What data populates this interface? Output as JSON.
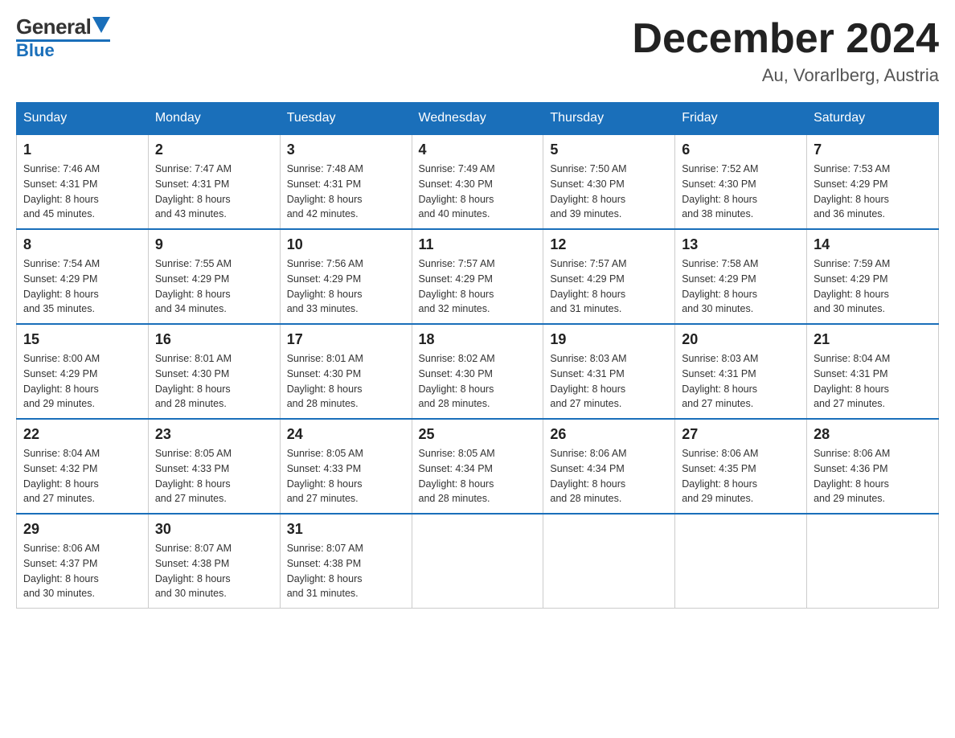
{
  "header": {
    "logo_general": "General",
    "logo_blue": "Blue",
    "title": "December 2024",
    "location": "Au, Vorarlberg, Austria"
  },
  "days_of_week": [
    "Sunday",
    "Monday",
    "Tuesday",
    "Wednesday",
    "Thursday",
    "Friday",
    "Saturday"
  ],
  "weeks": [
    [
      {
        "day": "1",
        "sunrise": "7:46 AM",
        "sunset": "4:31 PM",
        "daylight": "8 hours and 45 minutes."
      },
      {
        "day": "2",
        "sunrise": "7:47 AM",
        "sunset": "4:31 PM",
        "daylight": "8 hours and 43 minutes."
      },
      {
        "day": "3",
        "sunrise": "7:48 AM",
        "sunset": "4:31 PM",
        "daylight": "8 hours and 42 minutes."
      },
      {
        "day": "4",
        "sunrise": "7:49 AM",
        "sunset": "4:30 PM",
        "daylight": "8 hours and 40 minutes."
      },
      {
        "day": "5",
        "sunrise": "7:50 AM",
        "sunset": "4:30 PM",
        "daylight": "8 hours and 39 minutes."
      },
      {
        "day": "6",
        "sunrise": "7:52 AM",
        "sunset": "4:30 PM",
        "daylight": "8 hours and 38 minutes."
      },
      {
        "day": "7",
        "sunrise": "7:53 AM",
        "sunset": "4:29 PM",
        "daylight": "8 hours and 36 minutes."
      }
    ],
    [
      {
        "day": "8",
        "sunrise": "7:54 AM",
        "sunset": "4:29 PM",
        "daylight": "8 hours and 35 minutes."
      },
      {
        "day": "9",
        "sunrise": "7:55 AM",
        "sunset": "4:29 PM",
        "daylight": "8 hours and 34 minutes."
      },
      {
        "day": "10",
        "sunrise": "7:56 AM",
        "sunset": "4:29 PM",
        "daylight": "8 hours and 33 minutes."
      },
      {
        "day": "11",
        "sunrise": "7:57 AM",
        "sunset": "4:29 PM",
        "daylight": "8 hours and 32 minutes."
      },
      {
        "day": "12",
        "sunrise": "7:57 AM",
        "sunset": "4:29 PM",
        "daylight": "8 hours and 31 minutes."
      },
      {
        "day": "13",
        "sunrise": "7:58 AM",
        "sunset": "4:29 PM",
        "daylight": "8 hours and 30 minutes."
      },
      {
        "day": "14",
        "sunrise": "7:59 AM",
        "sunset": "4:29 PM",
        "daylight": "8 hours and 30 minutes."
      }
    ],
    [
      {
        "day": "15",
        "sunrise": "8:00 AM",
        "sunset": "4:29 PM",
        "daylight": "8 hours and 29 minutes."
      },
      {
        "day": "16",
        "sunrise": "8:01 AM",
        "sunset": "4:30 PM",
        "daylight": "8 hours and 28 minutes."
      },
      {
        "day": "17",
        "sunrise": "8:01 AM",
        "sunset": "4:30 PM",
        "daylight": "8 hours and 28 minutes."
      },
      {
        "day": "18",
        "sunrise": "8:02 AM",
        "sunset": "4:30 PM",
        "daylight": "8 hours and 28 minutes."
      },
      {
        "day": "19",
        "sunrise": "8:03 AM",
        "sunset": "4:31 PM",
        "daylight": "8 hours and 27 minutes."
      },
      {
        "day": "20",
        "sunrise": "8:03 AM",
        "sunset": "4:31 PM",
        "daylight": "8 hours and 27 minutes."
      },
      {
        "day": "21",
        "sunrise": "8:04 AM",
        "sunset": "4:31 PM",
        "daylight": "8 hours and 27 minutes."
      }
    ],
    [
      {
        "day": "22",
        "sunrise": "8:04 AM",
        "sunset": "4:32 PM",
        "daylight": "8 hours and 27 minutes."
      },
      {
        "day": "23",
        "sunrise": "8:05 AM",
        "sunset": "4:33 PM",
        "daylight": "8 hours and 27 minutes."
      },
      {
        "day": "24",
        "sunrise": "8:05 AM",
        "sunset": "4:33 PM",
        "daylight": "8 hours and 27 minutes."
      },
      {
        "day": "25",
        "sunrise": "8:05 AM",
        "sunset": "4:34 PM",
        "daylight": "8 hours and 28 minutes."
      },
      {
        "day": "26",
        "sunrise": "8:06 AM",
        "sunset": "4:34 PM",
        "daylight": "8 hours and 28 minutes."
      },
      {
        "day": "27",
        "sunrise": "8:06 AM",
        "sunset": "4:35 PM",
        "daylight": "8 hours and 29 minutes."
      },
      {
        "day": "28",
        "sunrise": "8:06 AM",
        "sunset": "4:36 PM",
        "daylight": "8 hours and 29 minutes."
      }
    ],
    [
      {
        "day": "29",
        "sunrise": "8:06 AM",
        "sunset": "4:37 PM",
        "daylight": "8 hours and 30 minutes."
      },
      {
        "day": "30",
        "sunrise": "8:07 AM",
        "sunset": "4:38 PM",
        "daylight": "8 hours and 30 minutes."
      },
      {
        "day": "31",
        "sunrise": "8:07 AM",
        "sunset": "4:38 PM",
        "daylight": "8 hours and 31 minutes."
      },
      null,
      null,
      null,
      null
    ]
  ],
  "labels": {
    "sunrise": "Sunrise:",
    "sunset": "Sunset:",
    "daylight": "Daylight:"
  }
}
